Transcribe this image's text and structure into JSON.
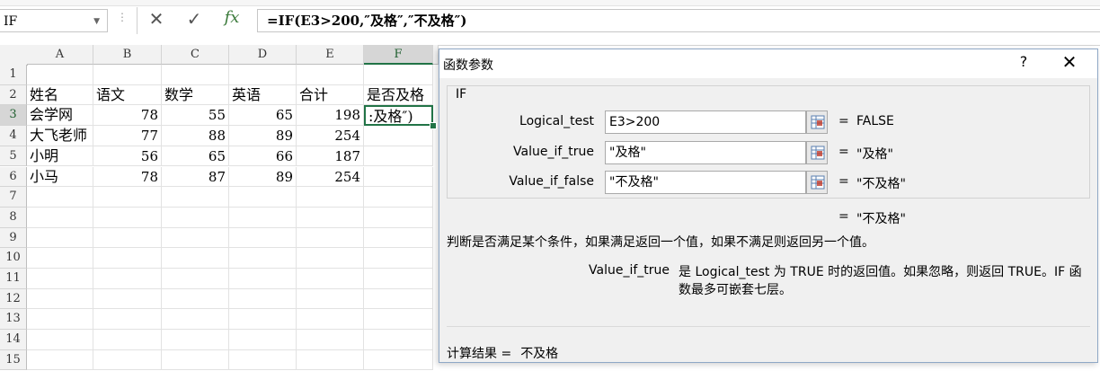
{
  "formula_bar": {
    "name_box": "IF",
    "cancel_icon": "✕",
    "enter_icon": "✓",
    "fx_label": "fx",
    "formula": "=IF(E3>200,″及格″,″不及格″)"
  },
  "grid": {
    "columns": [
      "A",
      "B",
      "C",
      "D",
      "E",
      "F"
    ],
    "rows": [
      "1",
      "2",
      "3",
      "4",
      "5",
      "6",
      "7",
      "8",
      "9",
      "10",
      "11",
      "12",
      "13",
      "14",
      "15"
    ],
    "header_row": [
      "姓名",
      "语文",
      "数学",
      "英语",
      "合计",
      "是否及格"
    ],
    "data_rows": [
      [
        "会学网",
        "78",
        "55",
        "65",
        "198",
        ":及格″)"
      ],
      [
        "大飞老师",
        "77",
        "88",
        "89",
        "254",
        ""
      ],
      [
        "小明",
        "56",
        "65",
        "66",
        "187",
        ""
      ],
      [
        "小马",
        "78",
        "87",
        "89",
        "254",
        ""
      ]
    ]
  },
  "dialog": {
    "title": "函数参数",
    "help_label": "?",
    "close_label": "✕",
    "function_name": "IF",
    "args": [
      {
        "label": "Logical_test",
        "value": "E3>200",
        "result": "FALSE"
      },
      {
        "label": "Value_if_true",
        "value": "\"及格\"",
        "result": "\"及格\""
      },
      {
        "label": "Value_if_false",
        "value": "\"不及格\"",
        "result": "\"不及格\""
      }
    ],
    "equals": "=",
    "formula_result": "\"不及格\"",
    "description": "判断是否满足某个条件，如果满足返回一个值，如果不满足则返回另一个值。",
    "arg_help_name": "Value_if_true",
    "arg_help_text": "是 Logical_test 为 TRUE 时的返回值。如果忽略，则返回 TRUE。IF 函数最多可嵌套七层。",
    "calc_label": "计算结果 =",
    "calc_value": "不及格"
  },
  "colors": {
    "accent": "#217346",
    "dialog_border": "#8fa8c6"
  }
}
